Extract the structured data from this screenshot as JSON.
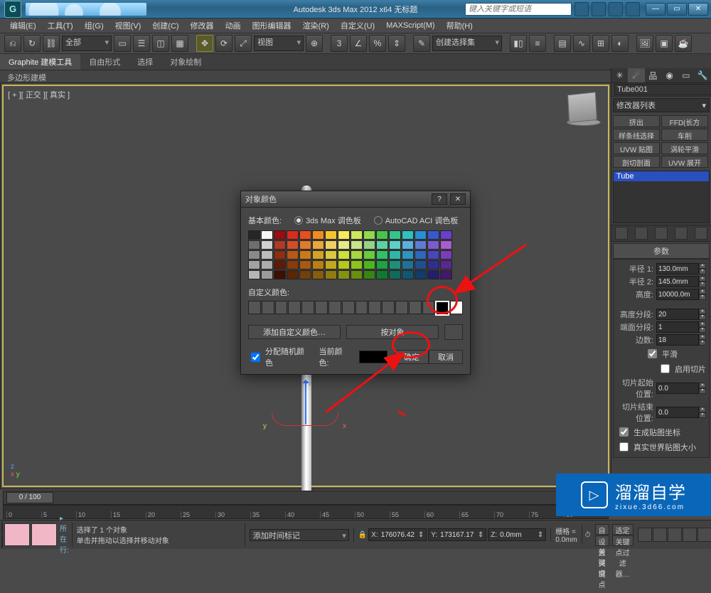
{
  "title": "Autodesk 3ds Max  2012 x64    无标题",
  "search_placeholder": "键入关键字或短语",
  "menus": [
    "编辑(E)",
    "工具(T)",
    "组(G)",
    "视图(V)",
    "创建(C)",
    "修改器",
    "动画",
    "图形编辑器",
    "渲染(R)",
    "自定义(U)",
    "MAXScript(M)",
    "帮助(H)"
  ],
  "toolbar": {
    "all": "全部",
    "view": "视图",
    "selset": "创建选择集"
  },
  "ribbon": {
    "tabs": [
      "Graphite 建模工具",
      "自由形式",
      "选择",
      "对象绘制"
    ],
    "sub": "多边形建模"
  },
  "viewport_label": "[ + ][ 正交 ][ 真实 ]",
  "dialog": {
    "title": "对象颜色",
    "basic": "基本颜色:",
    "pal_a": "3ds Max 调色板",
    "pal_b": "AutoCAD ACI 调色板",
    "custom": "自定义颜色:",
    "add": "添加自定义颜色…",
    "byobj": "按对象",
    "assign": "分配随机颜色",
    "current": "当前颜色:",
    "ok": "确定",
    "cancel": "取消"
  },
  "swatches": [
    "#262626",
    "#f5f5f5",
    "#9e0b12",
    "#dc2a1e",
    "#e84f1c",
    "#f08c1e",
    "#f4c430",
    "#f7e95b",
    "#cde85b",
    "#8fd94d",
    "#48c44b",
    "#35c48a",
    "#2fc0c0",
    "#2a8ed4",
    "#3a58ce",
    "#6a3fcc",
    "#6e6e6e",
    "#d0d0d0",
    "#b13a24",
    "#d24e28",
    "#e27a2b",
    "#eba63e",
    "#f0d060",
    "#e6e98a",
    "#c8e48a",
    "#96d28a",
    "#5fd0a0",
    "#5ecec8",
    "#5ab0de",
    "#5e7cd4",
    "#7a5cce",
    "#a85ccf",
    "#8a8a8a",
    "#bcbcbc",
    "#8e2e0e",
    "#b85818",
    "#cc7a18",
    "#d6a224",
    "#dcc83c",
    "#cde03c",
    "#a6d83c",
    "#6acc3c",
    "#2fc264",
    "#2fb8a6",
    "#2e94c2",
    "#2e68ba",
    "#4a46ba",
    "#7a3cba",
    "#a2a2a2",
    "#acacac",
    "#5e1c06",
    "#8a3a0c",
    "#a85a0e",
    "#bc7e12",
    "#c4a81c",
    "#b6c81c",
    "#8cc41c",
    "#4eb61c",
    "#1ea244",
    "#1e907a",
    "#1e729a",
    "#1e5090",
    "#322e90",
    "#5a2690",
    "#b6b6b6",
    "#9c9c9c",
    "#3a1204",
    "#5a2608",
    "#72400a",
    "#865c0e",
    "#8e7c12",
    "#849212",
    "#669012",
    "#388612",
    "#127830",
    "#126a5a",
    "#125672",
    "#123c6a",
    "#22206a",
    "#401a6a"
  ],
  "cmd": {
    "obj": "Tube001",
    "modlist": "修改器列表",
    "b1": "挤出",
    "b2": "FFD(长方体)",
    "b3": "样条线选择",
    "b4": "车削",
    "b5": "UVW 贴图",
    "b6": "涡轮平滑",
    "b7": "剖切剖面",
    "b8": "UVW 展开",
    "stack": "Tube",
    "roll": "参数",
    "r1": "半径 1:",
    "r1v": "130.0mm",
    "r2": "半径 2:",
    "r2v": "145.0mm",
    "h": "高度:",
    "hv": "10000.0m",
    "hs": "高度分段:",
    "hsv": "20",
    "cs": "端面分段:",
    "csv": "1",
    "sd": "边数:",
    "sdv": "18",
    "smooth": "平滑",
    "slice": "启用切片",
    "sa": "切片起始位置:",
    "sav": "0.0",
    "sb": "切片结束位置:",
    "sbv": "0.0",
    "gen": "生成贴图坐标",
    "real": "真实世界贴图大小"
  },
  "timeline": {
    "thumb": "0 / 100",
    "ticks": [
      "0",
      "5",
      "10",
      "15",
      "20",
      "25",
      "30",
      "35",
      "40",
      "45",
      "50",
      "55",
      "60",
      "65",
      "70",
      "75",
      "80"
    ]
  },
  "status": {
    "sel": "选择了 1 个对象",
    "hint": "单击并拖动以选择并移动对象",
    "x": "176076.42",
    "y": "173167.17",
    "z": "0.0mm",
    "grid": "栅格 = 0.0mm",
    "autokey": "自动关键点",
    "selsetbtn": "选定对象",
    "setkey": "设置关键点",
    "keyfilter": "关键点过滤器…",
    "addtag": "添加时间标记",
    "row": "所在行:"
  },
  "watermark": {
    "brand": "溜溜自学",
    "sub": "zixue.3d66.com"
  }
}
